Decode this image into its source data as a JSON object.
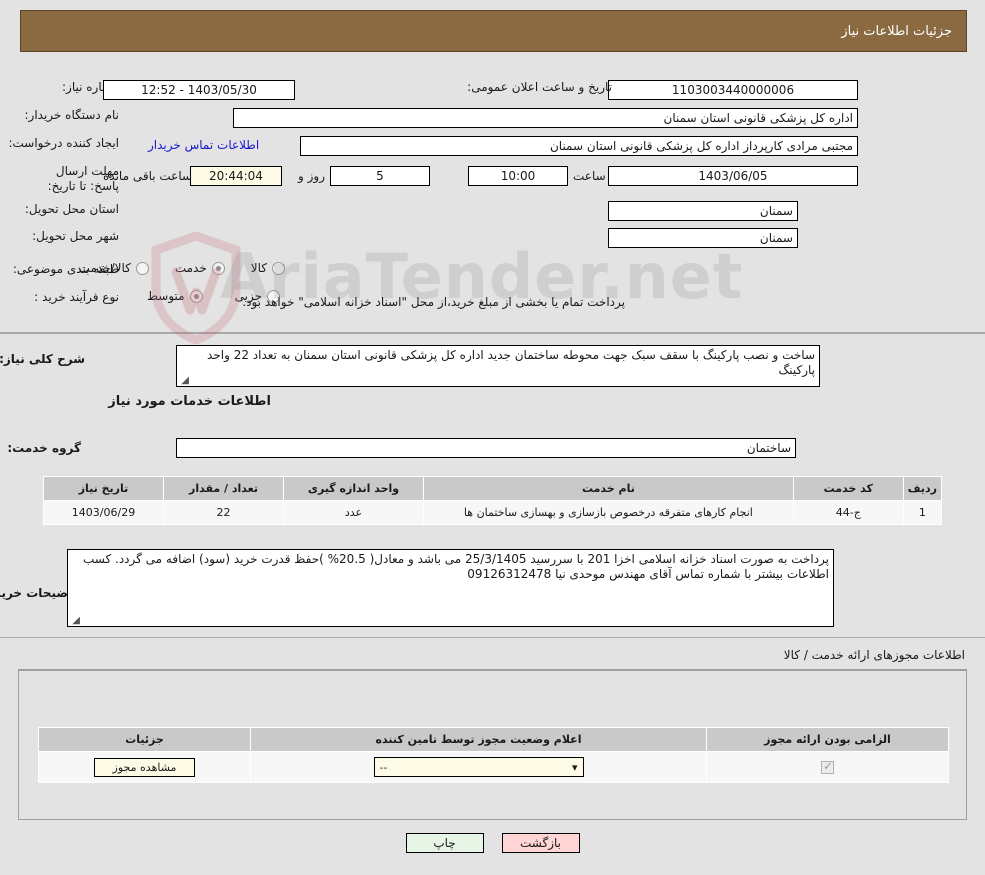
{
  "header": {
    "title": "جزئیات اطلاعات نیاز"
  },
  "watermark": {
    "text": "AriaTender.net"
  },
  "form": {
    "need_number_label": "شماره نیاز:",
    "need_number_value": "1103003440000006",
    "announce_datetime_label": "تاریخ و ساعت اعلان عمومی:",
    "announce_datetime_value": "1403/05/30 - 12:52",
    "buyer_org_label": "نام دستگاه خریدار:",
    "buyer_org_value": "اداره کل پزشکی قانونی استان سمنان",
    "creator_label": "ایجاد کننده درخواست:",
    "creator_value": "مجتبی مرادی کارپرداز اداره کل پزشکی قانونی استان سمنان",
    "contact_link": "اطلاعات تماس خریدار",
    "deadline_label": "مهلت ارسال پاسخ: تا تاریخ:",
    "deadline_date": "1403/06/05",
    "hour_label": "ساعت",
    "hour_value": "10:00",
    "days_value": "5",
    "days_label": "روز و",
    "countdown_value": "20:44:04",
    "countdown_label": "ساعت باقی مانده",
    "province_label": "استان محل تحویل:",
    "province_value": "سمنان",
    "city_label": "شهر محل تحویل:",
    "city_value": "سمنان",
    "category_label": "طبقه بندی موضوعی:",
    "category_options": [
      {
        "label": "کالا",
        "selected": false
      },
      {
        "label": "خدمت",
        "selected": true
      },
      {
        "label": "کالا/خدمت",
        "selected": false
      }
    ],
    "process_label": "نوع فرآیند خرید :",
    "process_options": [
      {
        "label": "جزیی",
        "selected": false
      },
      {
        "label": "متوسط",
        "selected": true
      }
    ],
    "payment_note": "پرداخت تمام یا بخشی از مبلغ خرید،از محل \"اسناد خزانه اسلامی\" خواهد بود."
  },
  "description": {
    "label": "شرح کلی نیاز:",
    "value": "ساخت و نصب پارکینگ با سقف سبک جهت محوطه ساختمان جدید اداره کل پزشکی قانونی استان سمنان به تعداد 22 واحد پارکینگ"
  },
  "services": {
    "section_title": "اطلاعات خدمات مورد نیاز",
    "group_label": "گروه خدمت:",
    "group_value": "ساختمان",
    "columns": [
      "ردیف",
      "کد خدمت",
      "نام خدمت",
      "واحد اندازه گیری",
      "تعداد / مقدار",
      "تاریخ نیاز"
    ],
    "rows": [
      {
        "index": "1",
        "code": "ج-44",
        "name": "انجام کارهای متفرقه درخصوص بازسازی و بهسازی ساختمان ها",
        "unit": "عدد",
        "quantity": "22",
        "need_date": "1403/06/29"
      }
    ]
  },
  "buyer_notes": {
    "label": "توضیحات خریدار:",
    "value": "پرداخت به صورت اسناد خزانه اسلامی اخزا 201 با سررسید 25/3/1405 می باشد و معادل( 20.5% )حفظ قدرت خرید (سود) اضافه می گردد. کسب اطلاعات بیشتر با شماره تماس آقای مهندس موحدی نیا 09126312478"
  },
  "licenses": {
    "label": "اطلاعات مجوزهای ارائه خدمت / کالا",
    "columns": [
      "الزامی بودن ارائه مجوز",
      "اعلام وضعیت مجوز توسط تامین کننده",
      "جزئیات"
    ],
    "rows": [
      {
        "required": true,
        "status_value": "--",
        "details_button": "مشاهده مجوز"
      }
    ]
  },
  "footer": {
    "back_label": "بازگشت",
    "print_label": "چاپ"
  }
}
